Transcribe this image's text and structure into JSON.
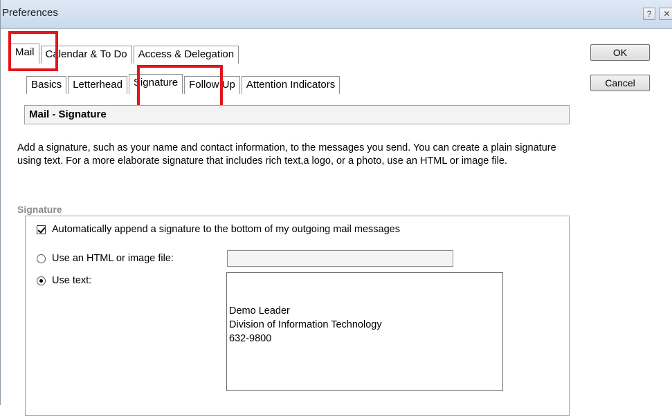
{
  "window": {
    "title": "Preferences",
    "help_label": "?",
    "close_label": "✕"
  },
  "tabs_main": [
    {
      "label": "Mail",
      "active": true
    },
    {
      "label": "Calendar & To Do",
      "active": false
    },
    {
      "label": "Access & Delegation",
      "active": false
    }
  ],
  "tabs_sub": [
    {
      "label": "Basics",
      "active": false
    },
    {
      "label": "Letterhead",
      "active": false
    },
    {
      "label": "Signature",
      "active": true
    },
    {
      "label": "Follow Up",
      "active": false
    },
    {
      "label": "Attention Indicators",
      "active": false
    }
  ],
  "buttons": {
    "ok": "OK",
    "cancel": "Cancel"
  },
  "panel": {
    "title": "Mail - Signature",
    "description": "Add a signature, such as your name and contact information, to the messages you send.  You can create a plain signature using text. For a more elaborate signature that includes rich text,a logo, or a photo, use an HTML or image file."
  },
  "signature": {
    "group_label": "Signature",
    "auto_append_label": "Automatically append a signature to the bottom of my outgoing mail messages",
    "auto_append_checked": true,
    "html_option_label": "Use an HTML or image file:",
    "html_option_selected": false,
    "html_file_value": "",
    "text_option_label": "Use text:",
    "text_option_selected": true,
    "text_value": "Demo Leader\nDivision of Information Technology\n632-9800"
  },
  "colors": {
    "highlight": "#e2151b",
    "titlebar": "#d4e1f0"
  }
}
